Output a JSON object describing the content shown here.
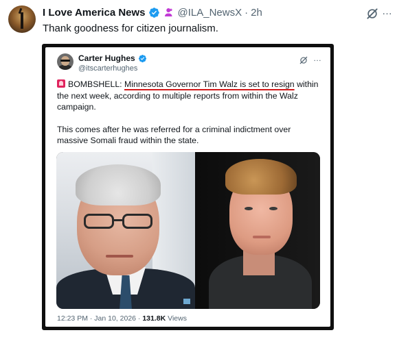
{
  "post": {
    "display_name": "I Love America News",
    "handle": "@ILA_NewsX",
    "separator": "·",
    "time": "2h",
    "text": "Thank goodness for citizen journalism.",
    "more_icon": "…"
  },
  "quote": {
    "display_name": "Carter Hughes",
    "handle": "@itscarterhughes",
    "bombshell_label": "BOMBSHELL:",
    "headline_underlined": "Minnesota Governor Tim Walz is set to resign",
    "headline_rest": "within the next week, according to multiple reports from within the Walz campaign.",
    "paragraph2": "This comes after he was referred for a criminal indictment over massive Somali fraud within the state.",
    "timestamp": "12:23 PM · Jan 10, 2026",
    "meta_separator": "·",
    "views_count": "131.8K",
    "views_label": "Views",
    "more_icon": "…"
  },
  "icons": {
    "verified": "verified-badge-icon",
    "affiliate": "affiliate-badge-icon",
    "grok": "grok-icon",
    "more": "more-options-icon",
    "siren": "siren-emoji-icon"
  },
  "colors": {
    "verified_blue": "#1d9bf0",
    "affiliate_purple": "#c13ad5",
    "text_primary": "#0f1419",
    "text_secondary": "#536471",
    "underline_red": "#d11919"
  }
}
